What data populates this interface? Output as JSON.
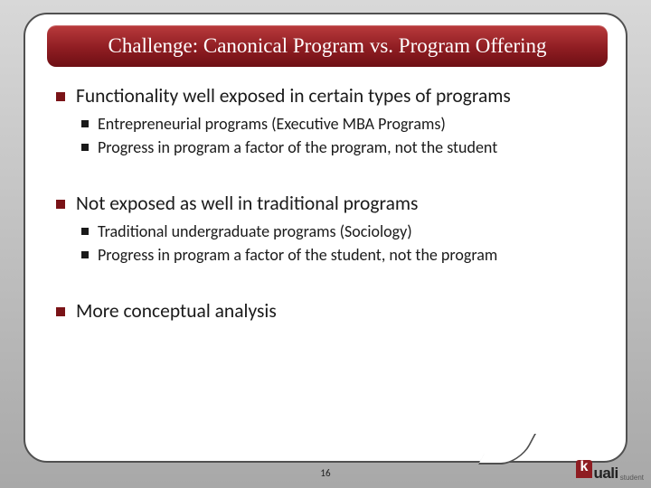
{
  "title": "Challenge: Canonical Program vs. Program Offering",
  "bullets": [
    {
      "text": "Functionality well exposed in certain types of programs",
      "children": [
        "Entrepreneurial programs (Executive MBA Programs)",
        "Progress in program a factor of the program, not the student"
      ]
    },
    {
      "text": "Not exposed as well in traditional programs",
      "children": [
        "Traditional undergraduate programs (Sociology)",
        "Progress in program a factor of the student, not the program"
      ]
    },
    {
      "text": "More conceptual analysis",
      "children": []
    }
  ],
  "page_number": "16",
  "logo": {
    "brand": "uali",
    "sub": "student"
  }
}
